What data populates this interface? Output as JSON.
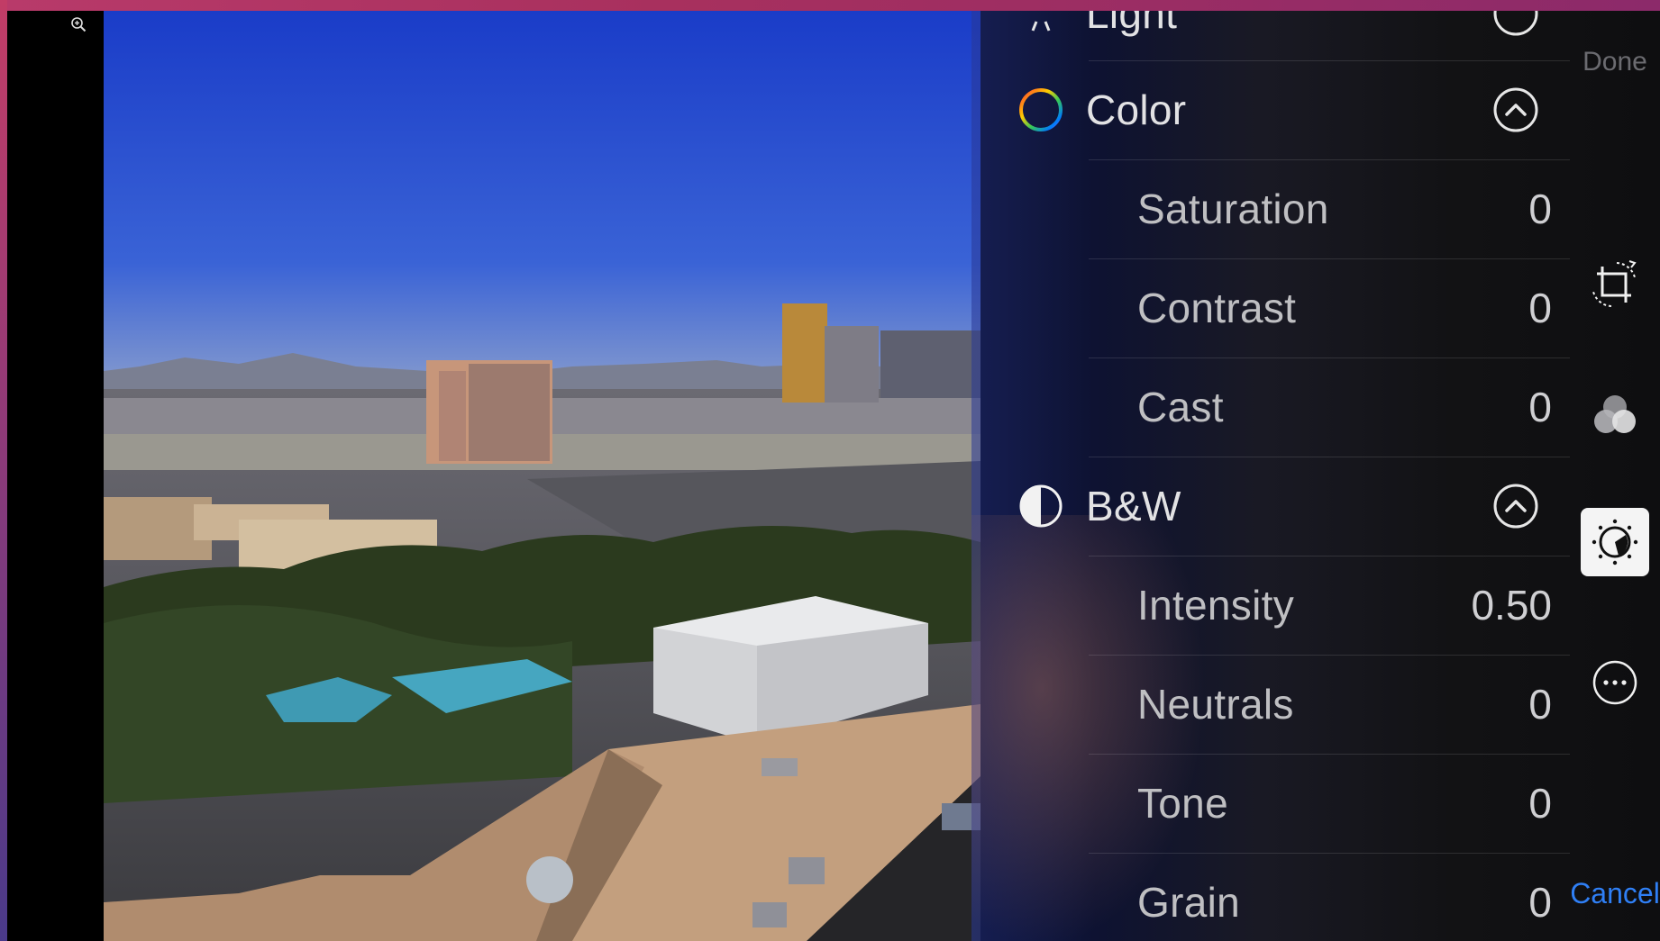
{
  "panel": {
    "partial_section": "Light",
    "sections": [
      {
        "title": "Color",
        "icon": "color-wheel-icon",
        "items": [
          {
            "label": "Saturation",
            "value": "0"
          },
          {
            "label": "Contrast",
            "value": "0"
          },
          {
            "label": "Cast",
            "value": "0"
          }
        ]
      },
      {
        "title": "B&W",
        "icon": "half-circle-icon",
        "items": [
          {
            "label": "Intensity",
            "value": "0.50"
          },
          {
            "label": "Neutrals",
            "value": "0"
          },
          {
            "label": "Tone",
            "value": "0"
          },
          {
            "label": "Grain",
            "value": "0"
          }
        ]
      }
    ]
  },
  "toolbar": {
    "done_label": "Done",
    "cancel_label": "Cancel",
    "tools": [
      "crop-rotate-icon",
      "filters-icon",
      "adjust-icon",
      "more-icon"
    ],
    "active_tool": "adjust-icon"
  },
  "colors": {
    "accent": "#2f7ff5",
    "done_disabled": "#6b6b70",
    "frame": "#b83a6a"
  }
}
